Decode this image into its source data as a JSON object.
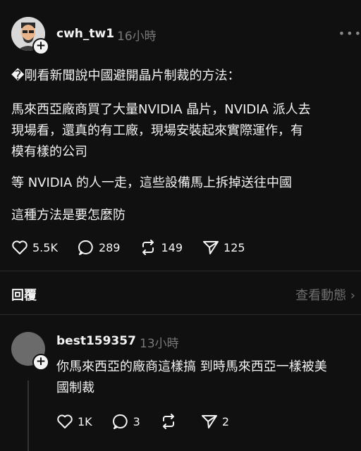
{
  "post": {
    "username": "cwh_tw1",
    "timestamp": "16小時",
    "more_icon": "more-dots-icon",
    "lines": [
      "�剛看新聞說中國避開晶片制裁的方法：",
      "馬來西亞廠商買了大量NVIDIA 晶片，NVIDIA 派人去",
      "現場看，還真的有工廠，現場安裝起來實際運作，有",
      "模有樣的公司",
      "等 NVIDIA 的人一走，這些設備馬上拆掉送往中國",
      "這種方法是要怎麼防"
    ],
    "stats": {
      "likes": "5.5K",
      "comments": "289",
      "reposts": "149",
      "shares": "125"
    }
  },
  "replies_section": {
    "label": "回覆",
    "view_activity": "查看動態 ›"
  },
  "reply": {
    "username": "best159357",
    "timestamp": "13小時",
    "lines": [
      "你馬來西亞的廠商這樣搞 到時馬來西亞一樣被美",
      "國制裁"
    ],
    "stats": {
      "likes": "1K",
      "comments": "3",
      "reposts": "",
      "shares": "2"
    }
  },
  "colors": {
    "background": "#101010",
    "text": "#f3f3f3",
    "muted": "#7a7a7a"
  }
}
